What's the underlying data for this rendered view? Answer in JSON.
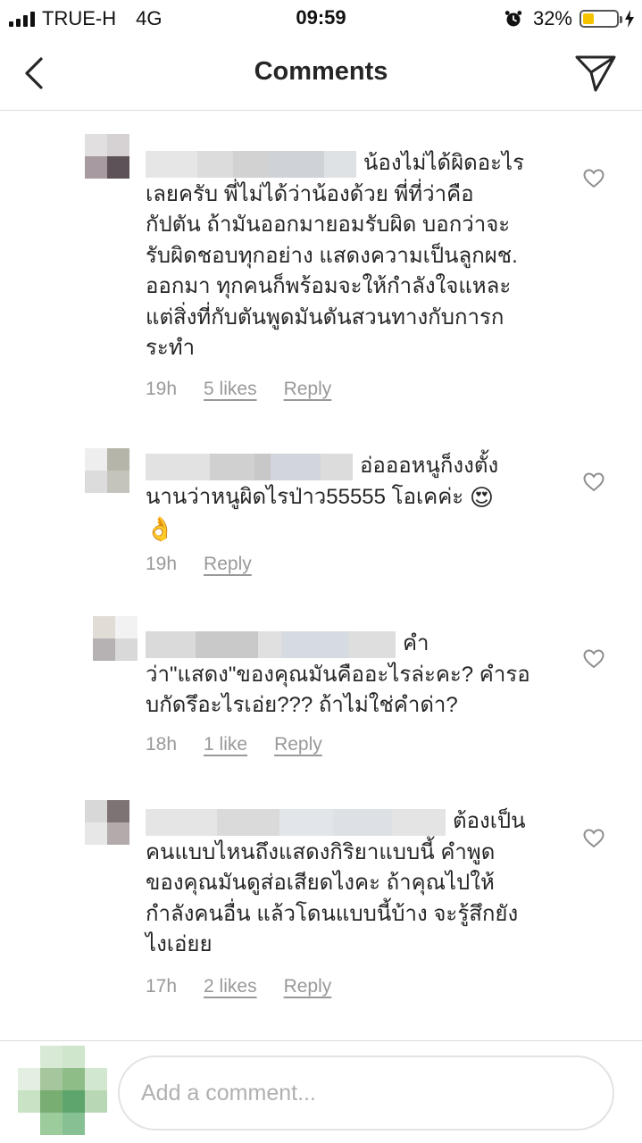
{
  "status_bar": {
    "carrier": "TRUE-H",
    "network": "4G",
    "time": "09:59",
    "battery": "32%",
    "battery_level": 0.32,
    "battery_color": "#f5c400"
  },
  "header": {
    "title": "Comments",
    "back_icon": "chevron-left-icon",
    "send_icon": "paper-plane-icon"
  },
  "comments": [
    {
      "lines": [
        "น้องไม่ได้ผิดอะไร",
        "เลยครับ พี่ไม่ได้ว่าน้องด้วย พี่ที่ว่าคือ",
        "กัปตัน ถ้ามันออกมายอมรับผิด บอกว่าจะ",
        "รับผิดชอบทุกอย่าง แสดงความเป็นลูกผช.",
        "ออกมา ทุกคนก็พร้อมจะให้กำลังใจแหละ",
        "แต่สิ่งที่กับตันพูดมันดันสวนทางกับการก",
        "ระทำ"
      ],
      "time": "19h",
      "likes": "5 likes",
      "reply": "Reply"
    },
    {
      "lines": [
        "อ่อออหนูก็งงตั้ง",
        "นานว่าหนูผิดไรป่าว55555 โอเคค่ะ"
      ],
      "emoji_inline": "😍",
      "emoji_line": "👌",
      "time": "19h",
      "reply": "Reply"
    },
    {
      "lines": [
        "คำ",
        "ว่า\"แสดง\"ของคุณมันคืออะไรล่ะคะ? คำรอ",
        "บกัดรึอะไรเอ่ย??? ถ้าไม่ใช่คำด่า?"
      ],
      "time": "18h",
      "likes": "1 like",
      "reply": "Reply"
    },
    {
      "lines": [
        "ต้องเป็น",
        "คนแบบไหนถึงแสดงกิริยาแบบนี้ คำพูด",
        "ของคุณมันดูส่อเสียดไงคะ ถ้าคุณไปให้",
        "กำลังคนอื่น แล้วโดนแบบนี้บ้าง จะรู้สึกยัง",
        "ไงเอ่ยย"
      ],
      "time": "17h",
      "likes": "2 likes",
      "reply": "Reply"
    }
  ],
  "composer": {
    "placeholder": "Add a comment..."
  }
}
